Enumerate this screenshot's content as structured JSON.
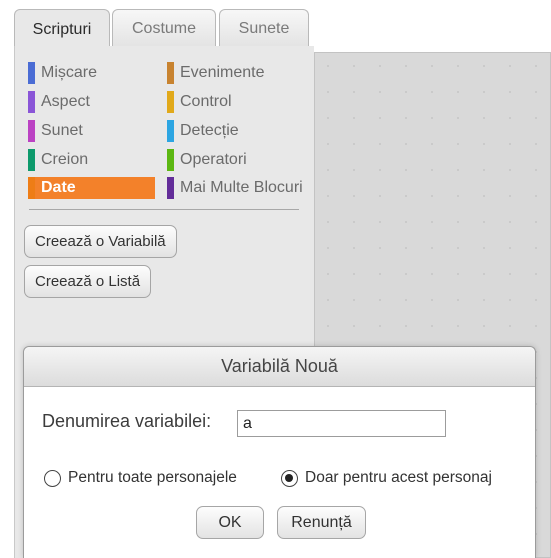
{
  "tabs": [
    {
      "label": "Scripturi",
      "active": true
    },
    {
      "label": "Costume",
      "active": false
    },
    {
      "label": "Sunete",
      "active": false
    }
  ],
  "categories": [
    {
      "label": "Mișcare",
      "color": "#4a6cd4"
    },
    {
      "label": "Aspect",
      "color": "#8a55d7"
    },
    {
      "label": "Sunet",
      "color": "#bb42c3"
    },
    {
      "label": "Creion",
      "color": "#0e9a6c"
    },
    {
      "label": "Date",
      "color": "#ee7d16",
      "selected": true
    },
    {
      "label": "Evenimente",
      "color": "#c88330"
    },
    {
      "label": "Control",
      "color": "#e1a91a"
    },
    {
      "label": "Detecție",
      "color": "#2ca5e2"
    },
    {
      "label": "Operatori",
      "color": "#5cb712"
    },
    {
      "label": "Mai Multe Blocuri",
      "color": "#632d99"
    }
  ],
  "palette_buttons": {
    "make_variable": "Creează o Variabilă",
    "make_list": "Creează o Listă"
  },
  "dialog": {
    "title": "Variabilă Nouă",
    "name_label": "Denumirea variabilei:",
    "name_value": "a",
    "radio_all": "Pentru toate personajele",
    "radio_this": "Doar pentru acest personaj",
    "selected_scope": "this",
    "ok_label": "OK",
    "cancel_label": "Renunță"
  }
}
